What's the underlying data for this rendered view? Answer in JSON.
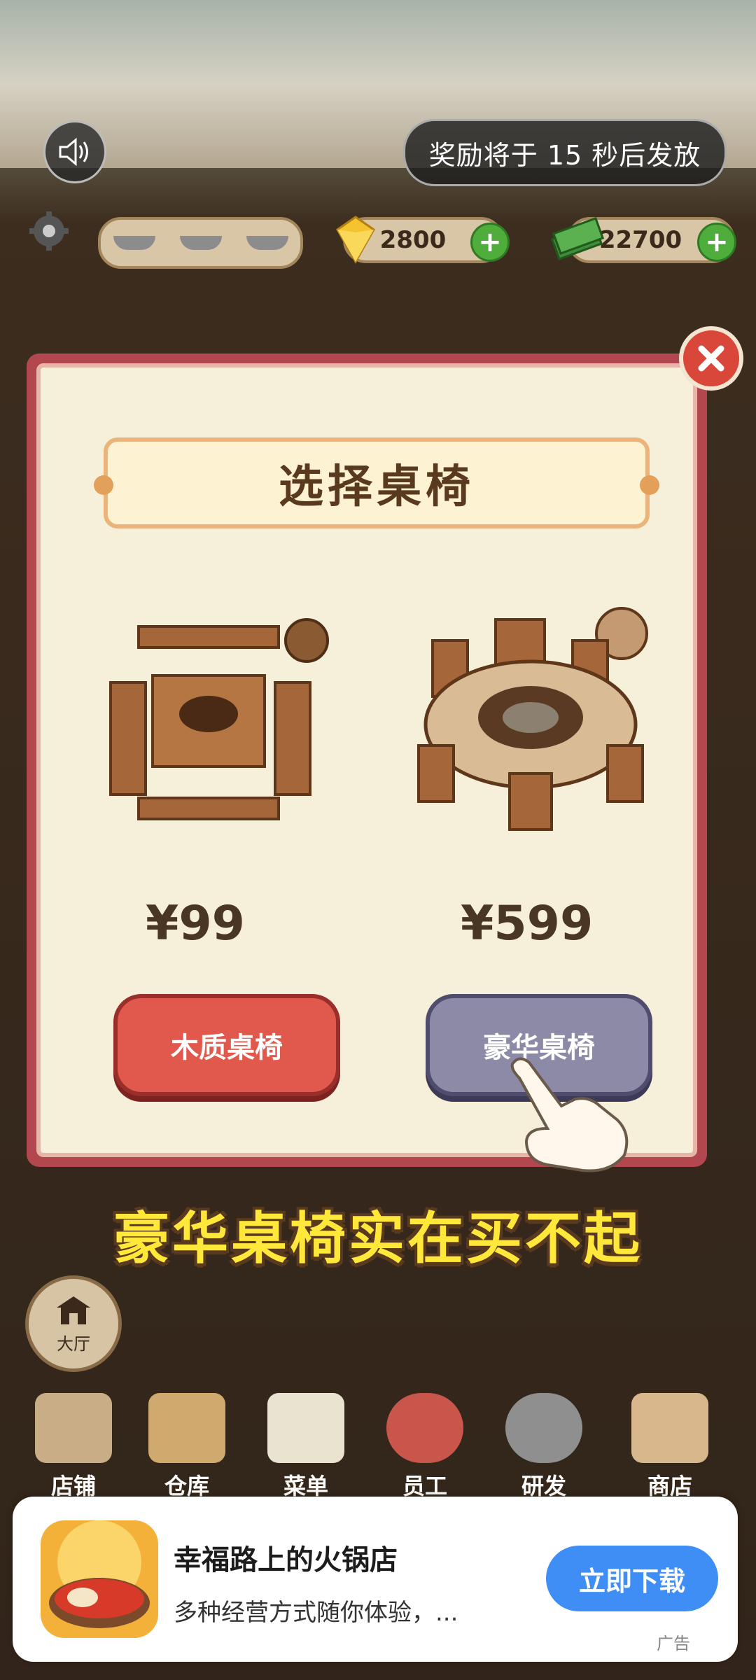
{
  "hud": {
    "coins": "2800",
    "cash": "22700"
  },
  "overlay": {
    "reward_text": "奖励将于 15 秒后发放"
  },
  "modal": {
    "title": "选择桌椅",
    "options": [
      {
        "price": "¥99",
        "button": "木质桌椅"
      },
      {
        "price": "¥599",
        "button": "豪华桌椅"
      }
    ]
  },
  "caption": "豪华桌椅实在买不起",
  "nav": {
    "hall": "大厅",
    "items": [
      "店铺",
      "仓库",
      "菜单",
      "员工",
      "研发",
      "商店"
    ]
  },
  "ad": {
    "title": "幸福路上的火锅店",
    "subtitle": "多种经营方式随你体验，...",
    "button": "立即下载",
    "tag": "广告"
  },
  "colors": {
    "wood_button": "#e1594c",
    "lux_button": "#8d8aa8",
    "caption": "#ffe83a",
    "ad_button": "#3e8ef5"
  }
}
